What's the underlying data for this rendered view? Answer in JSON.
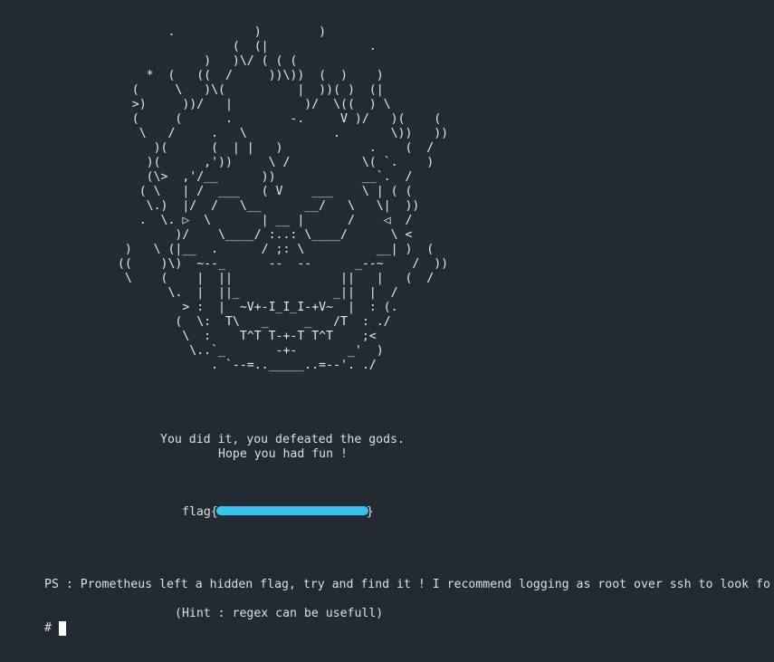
{
  "terminal": {
    "ascii_art": "         .           )        )\n                  (  (|              .\n              )   )\\/ ( ( (\n      *  (   ((  /     ))\\))  (  )    )\n    (     \\   )\\(          |  ))( )  (|\n    >)     ))/   |          )/  \\((  ) \\\n    (     (      .        -.     V )/   )(    (\n     \\   /     .   \\            .       \\))   ))\n       )(      (  | |   )            .    (  /\n      )(      ,'))     \\ /          \\( `.    )\n      (\\>  ,'/__      ))            __`.  /\n     ( \\   | /  ___   ( V    ___    \\ | ( (\n      \\.)  |/  /   \\__      __/   \\   \\|  ))\n     .  \\. ▷  \\       | __ |      /    ◁  /\n          )/    \\____/ :..: \\____/      \\ <\n   )   \\ (|__  .      / ;: \\          __| )  (\n  ((    )\\)  ~--_      --  --      _--~    /  ))\n   \\    (    |  ||               ||   |   (  /\n         \\.  |  ||_             _||  |  /\n           > :  |  ~V+-I_I_I-+V~  |  : (.\n          (  \\:  T\\   _     _   /T  : ./\n           \\  :    T^T T-+-T T^T    ;<\n            \\..`_       -+-       _'  )\n               . `--=.._____..=--'. ./",
    "victory_text": "You did it, you defeated the gods.",
    "hope_text": "Hope you had fun !",
    "flag_prefix": "flag{",
    "flag_suffix": "}",
    "ps_text": "PS : Prometheus left a hidden flag, try and find it ! I recommend logging as root over ssh to look fo",
    "hint_text": "(Hint : regex can be usefull)",
    "prompt": "#",
    "colors": {
      "background": "#242a33",
      "text": "#dcdfe4",
      "redaction": "#38c3f0",
      "cursor": "#ffffff"
    }
  }
}
